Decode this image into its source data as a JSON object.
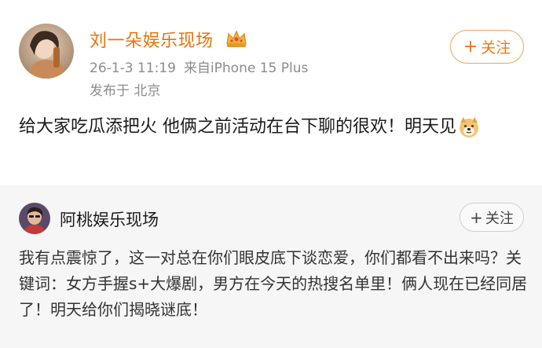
{
  "post": {
    "author_name": "刘一朵娱乐现场",
    "time": "26-1-3 11:19",
    "source": "来自iPhone 15 Plus",
    "location": "发布于 北京",
    "follow_label": "关注",
    "follow_plus": "+",
    "text": "给大家吃瓜添把火 他俩之前活动在台下聊的很欢！明天见",
    "emoji": "doge-emoji",
    "badge_icon": "crown-icon",
    "accent_color": "#e8740c"
  },
  "repost": {
    "author_name": "阿桃娱乐现场",
    "follow_label": "关注",
    "follow_plus": "+",
    "text": "我有点震惊了，这一对总在你们眼皮底下谈恋爱，你们都看不出来吗？关键词：女方手握s+大爆剧，男方在今天的热搜名单里！俩人现在已经同居了！明天给你们揭晓谜底！",
    "background_color": "#f6f6f6"
  }
}
